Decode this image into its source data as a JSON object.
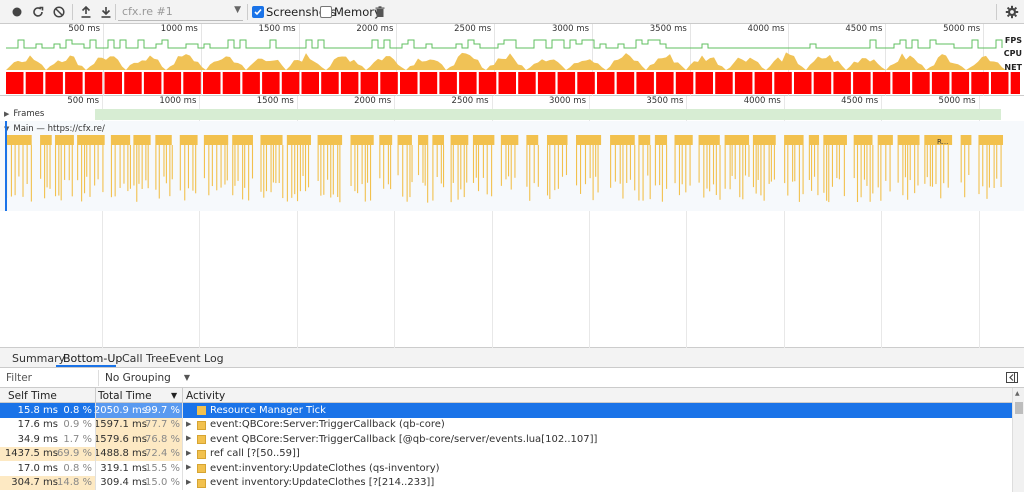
{
  "toolbar": {
    "target_label": "cfx.re #1",
    "screenshots_label": "Screenshots",
    "screenshots_checked": true,
    "memory_label": "Memory",
    "memory_checked": false
  },
  "overview": {
    "tick_labels": [
      "500 ms",
      "1000 ms",
      "1500 ms",
      "2000 ms",
      "2500 ms",
      "3000 ms",
      "3500 ms",
      "4000 ms",
      "4500 ms",
      "5000 ms"
    ],
    "fps_label": "FPS",
    "cpu_label": "CPU",
    "net_label": "NET"
  },
  "timeline": {
    "tick_labels": [
      "500 ms",
      "1000 ms",
      "1500 ms",
      "2000 ms",
      "2500 ms",
      "3000 ms",
      "3500 ms",
      "4000 ms",
      "4500 ms",
      "5000 ms"
    ],
    "frames_label": "Frames",
    "main_label": "Main — https://cfx.re/",
    "flame_label": "R..."
  },
  "tabs": [
    {
      "label": "Summary"
    },
    {
      "label": "Bottom-Up"
    },
    {
      "label": "Call Tree"
    },
    {
      "label": "Event Log"
    }
  ],
  "filter": {
    "placeholder": "Filter",
    "grouping": "No Grouping"
  },
  "table": {
    "headers": {
      "self": "Self Time",
      "total": "Total Time",
      "activity": "Activity"
    },
    "rows": [
      {
        "self": "15.8 ms",
        "self_pct": "0.8 %",
        "total": "2050.9 ms",
        "total_pct": "99.7 %",
        "activity": "Resource Manager Tick",
        "expandable": false
      },
      {
        "self": "17.6 ms",
        "self_pct": "0.9 %",
        "total": "1597.1 ms",
        "total_pct": "77.7 %",
        "activity": "event:QBCore:Server:TriggerCallback (qb-core)",
        "expandable": true
      },
      {
        "self": "34.9 ms",
        "self_pct": "1.7 %",
        "total": "1579.6 ms",
        "total_pct": "76.8 %",
        "activity": "event QBCore:Server:TriggerCallback [@qb-core/server/events.lua[102..107]]",
        "expandable": true
      },
      {
        "self": "1437.5 ms",
        "self_pct": "69.9 %",
        "total": "1488.8 ms",
        "total_pct": "72.4 %",
        "activity": "ref call [?[50..59]]",
        "expandable": true
      },
      {
        "self": "17.0 ms",
        "self_pct": "0.8 %",
        "total": "319.1 ms",
        "total_pct": "15.5 %",
        "activity": "event:inventory:UpdateClothes (qs-inventory)",
        "expandable": true
      },
      {
        "self": "304.7 ms",
        "self_pct": "14.8 %",
        "total": "309.4 ms",
        "total_pct": "15.0 %",
        "activity": "event inventory:UpdateClothes [?[214..233]]",
        "expandable": true
      }
    ]
  }
}
